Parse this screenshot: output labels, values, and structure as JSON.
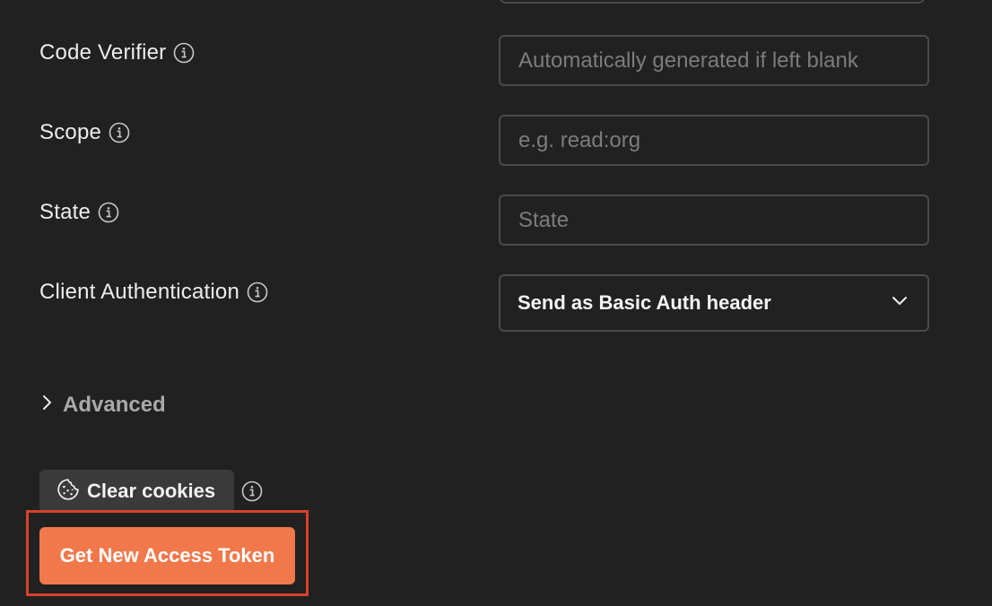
{
  "form": {
    "code_verifier": {
      "label": "Code Verifier",
      "value": "",
      "placeholder": "Automatically generated if left blank"
    },
    "scope": {
      "label": "Scope",
      "value": "",
      "placeholder": "e.g. read:org"
    },
    "state": {
      "label": "State",
      "value": "",
      "placeholder": "State"
    },
    "client_authentication": {
      "label": "Client Authentication",
      "selected": "Send as Basic Auth header"
    }
  },
  "advanced": {
    "label": "Advanced",
    "expanded": false
  },
  "clear_cookies": {
    "label": "Clear cookies",
    "icon": "cookie-icon"
  },
  "get_token": {
    "label": "Get New Access Token",
    "color": "#f0784b",
    "highlight_color": "#d9412b"
  },
  "colors": {
    "background": "#212121",
    "border": "#4a4a4a",
    "placeholder": "#7c7c7c"
  }
}
